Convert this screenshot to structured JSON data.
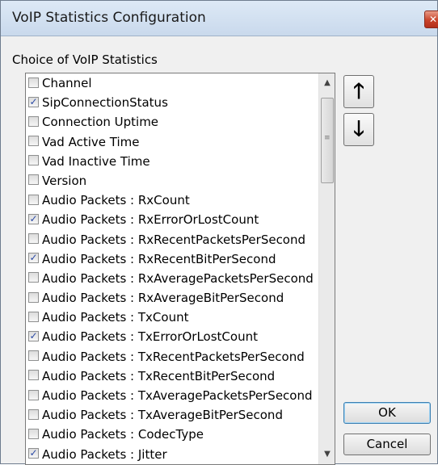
{
  "window": {
    "title": "VoIP Statistics Configuration",
    "close_glyph": "✕"
  },
  "group_label": "Choice of VoIP Statistics",
  "items": [
    {
      "label": "Channel",
      "checked": false
    },
    {
      "label": "SipConnectionStatus",
      "checked": true
    },
    {
      "label": "Connection Uptime",
      "checked": false
    },
    {
      "label": "Vad Active Time",
      "checked": false
    },
    {
      "label": "Vad Inactive Time",
      "checked": false
    },
    {
      "label": "Version",
      "checked": false
    },
    {
      "label": "Audio Packets : RxCount",
      "checked": false
    },
    {
      "label": "Audio Packets : RxErrorOrLostCount",
      "checked": true
    },
    {
      "label": "Audio Packets : RxRecentPacketsPerSecond",
      "checked": false
    },
    {
      "label": "Audio Packets : RxRecentBitPerSecond",
      "checked": true
    },
    {
      "label": "Audio Packets : RxAveragePacketsPerSecond",
      "checked": false
    },
    {
      "label": "Audio Packets : RxAverageBitPerSecond",
      "checked": false
    },
    {
      "label": "Audio Packets : TxCount",
      "checked": false
    },
    {
      "label": "Audio Packets : TxErrorOrLostCount",
      "checked": true
    },
    {
      "label": "Audio Packets : TxRecentPacketsPerSecond",
      "checked": false
    },
    {
      "label": "Audio Packets : TxRecentBitPerSecond",
      "checked": false
    },
    {
      "label": "Audio Packets : TxAveragePacketsPerSecond",
      "checked": false
    },
    {
      "label": "Audio Packets : TxAverageBitPerSecond",
      "checked": false
    },
    {
      "label": "Audio Packets : CodecType",
      "checked": false
    },
    {
      "label": "Audio Packets : Jitter",
      "checked": true
    }
  ],
  "icons": {
    "move_up": "arrow-up-icon",
    "move_down": "arrow-down-icon",
    "scroll_up": "scroll-up-icon",
    "scroll_down": "scroll-down-icon"
  },
  "glyphs": {
    "move_up": "🡑",
    "move_down": "🡓",
    "scroll_up": "▲",
    "scroll_down": "▼",
    "check": "✓"
  },
  "buttons": {
    "ok": "OK",
    "cancel": "Cancel"
  },
  "colors": {
    "check": "#2b4aa5",
    "ok_border": "#3c7fb1",
    "close": "#c9442b"
  }
}
